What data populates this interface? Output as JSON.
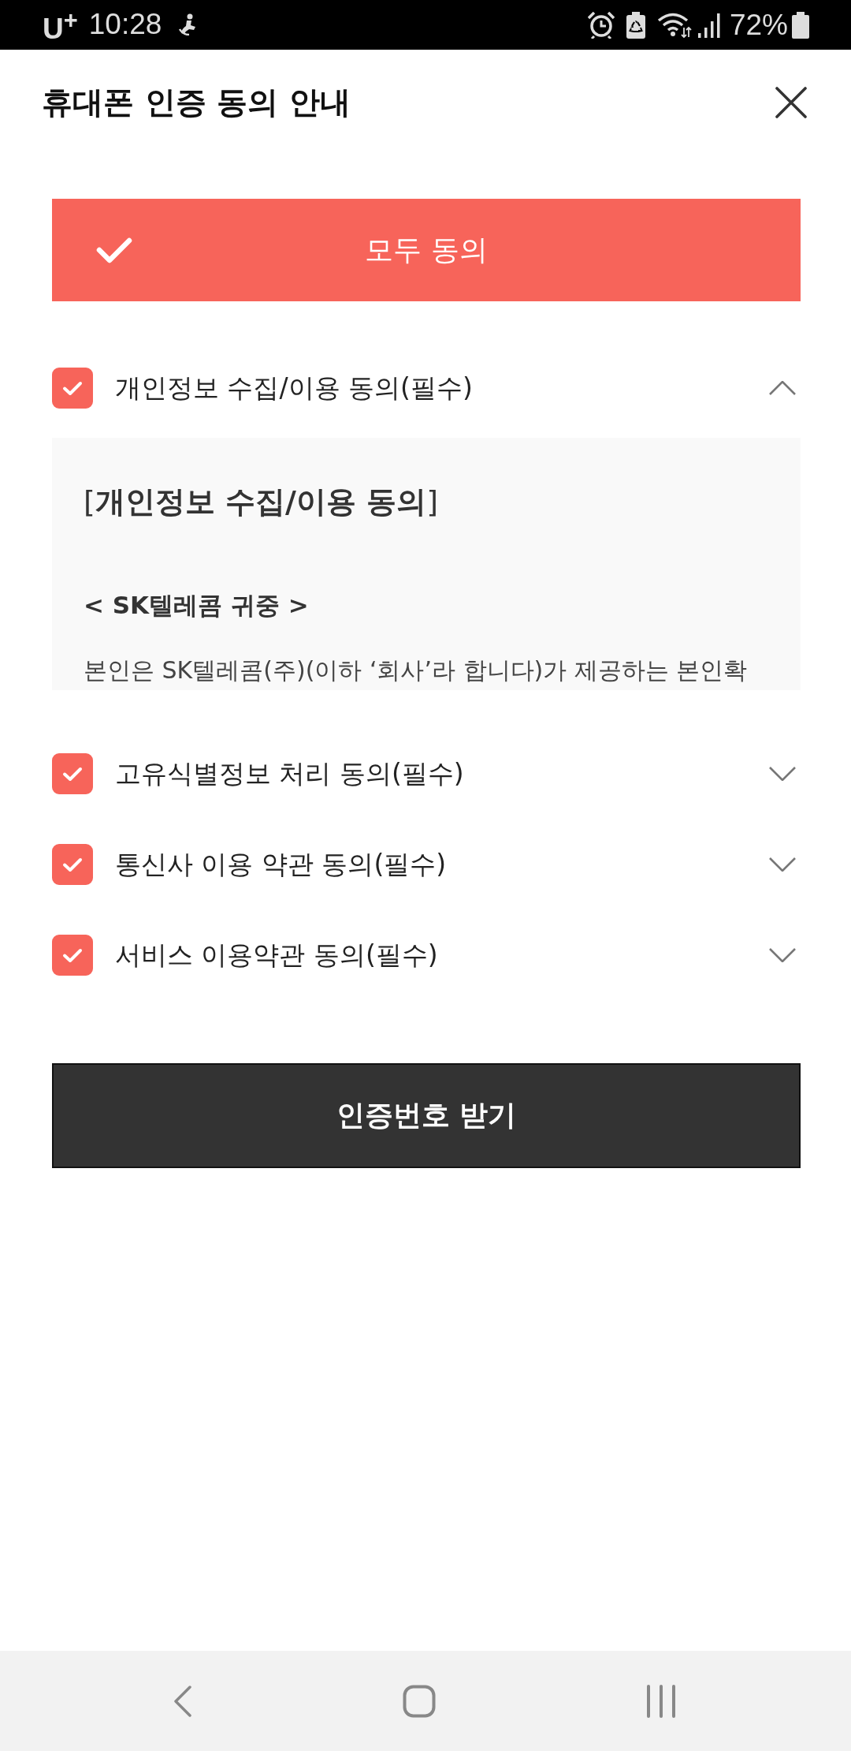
{
  "status_bar": {
    "carrier": "U$^{+}$",
    "time": "10:28",
    "battery": "72%"
  },
  "header": {
    "title": "휴대폰 인증 동의 안내"
  },
  "agree_all": {
    "label": "모두 동의",
    "checked": true
  },
  "terms": [
    {
      "label": "개인정보 수집/이용 동의(필수)",
      "checked": true,
      "expanded": true,
      "content": {
        "heading": "[**개인정보 수집/이용 동의**]",
        "recipient": "< SK텔레콤 귀중 >",
        "body": "본인은 SK텔레콤(주)(이하 ‘회사’라 합니다)가 제공하는 본인확"
      }
    },
    {
      "label": "고유식별정보 처리 동의(필수)",
      "checked": true,
      "expanded": false
    },
    {
      "label": "통신사 이용 약관 동의(필수)",
      "checked": true,
      "expanded": false
    },
    {
      "label": "서비스 이용약관 동의(필수)",
      "checked": true,
      "expanded": false
    }
  ],
  "submit_button": {
    "label": "인증번호 받기"
  }
}
